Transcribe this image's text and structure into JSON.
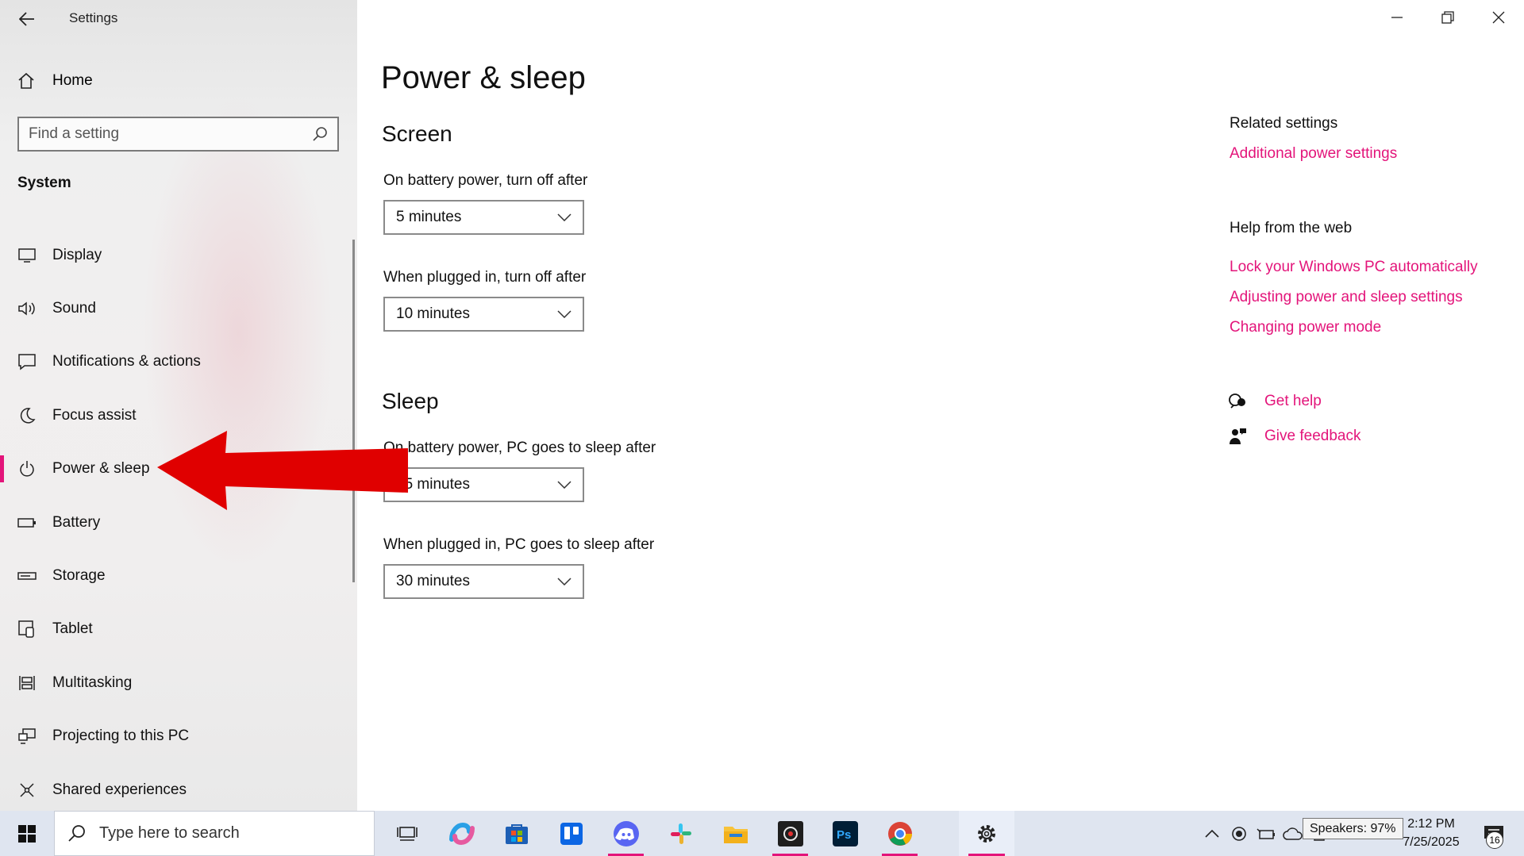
{
  "window": {
    "app_title": "Settings",
    "back_icon": "arrow-left-icon",
    "controls": {
      "minimize_icon": "minimize-icon",
      "restore_icon": "restore-icon",
      "close_icon": "close-icon"
    }
  },
  "sidebar": {
    "home_label": "Home",
    "search": {
      "placeholder": "Find a setting",
      "icon": "search-icon"
    },
    "section_label": "System",
    "items": [
      {
        "label": "Display",
        "icon": "monitor-icon"
      },
      {
        "label": "Sound",
        "icon": "speaker-icon"
      },
      {
        "label": "Notifications & actions",
        "icon": "message-icon"
      },
      {
        "label": "Focus assist",
        "icon": "moon-icon"
      },
      {
        "label": "Power & sleep",
        "icon": "power-icon",
        "active": true
      },
      {
        "label": "Battery",
        "icon": "battery-icon"
      },
      {
        "label": "Storage",
        "icon": "storage-icon"
      },
      {
        "label": "Tablet",
        "icon": "tablet-icon"
      },
      {
        "label": "Multitasking",
        "icon": "multitasking-icon"
      },
      {
        "label": "Projecting to this PC",
        "icon": "projector-icon"
      },
      {
        "label": "Shared experiences",
        "icon": "shared-icon"
      }
    ]
  },
  "main": {
    "title": "Power & sleep",
    "screen": {
      "heading": "Screen",
      "battery_label": "On battery power, turn off after",
      "battery_value": "5 minutes",
      "plugged_label": "When plugged in, turn off after",
      "plugged_value": "10 minutes"
    },
    "sleep": {
      "heading": "Sleep",
      "battery_label": "On battery power, PC goes to sleep after",
      "battery_value": "15 minutes",
      "plugged_label": "When plugged in, PC goes to sleep after",
      "plugged_value": "30 minutes"
    }
  },
  "right": {
    "related_heading": "Related settings",
    "related_link": "Additional power settings",
    "web_heading": "Help from the web",
    "web_links": [
      "Lock your Windows PC automatically",
      "Adjusting power and sleep settings",
      "Changing power mode"
    ],
    "get_help": "Get help",
    "give_feedback": "Give feedback"
  },
  "taskbar": {
    "search_placeholder": "Type here to search",
    "tooltip": "Speakers: 97%",
    "time": "2:12 PM",
    "date": "7/25/2025",
    "notification_count": "16"
  },
  "colors": {
    "accent": "#e3147a",
    "arrow": "#e00000",
    "taskbar": "#dfe5f0"
  }
}
